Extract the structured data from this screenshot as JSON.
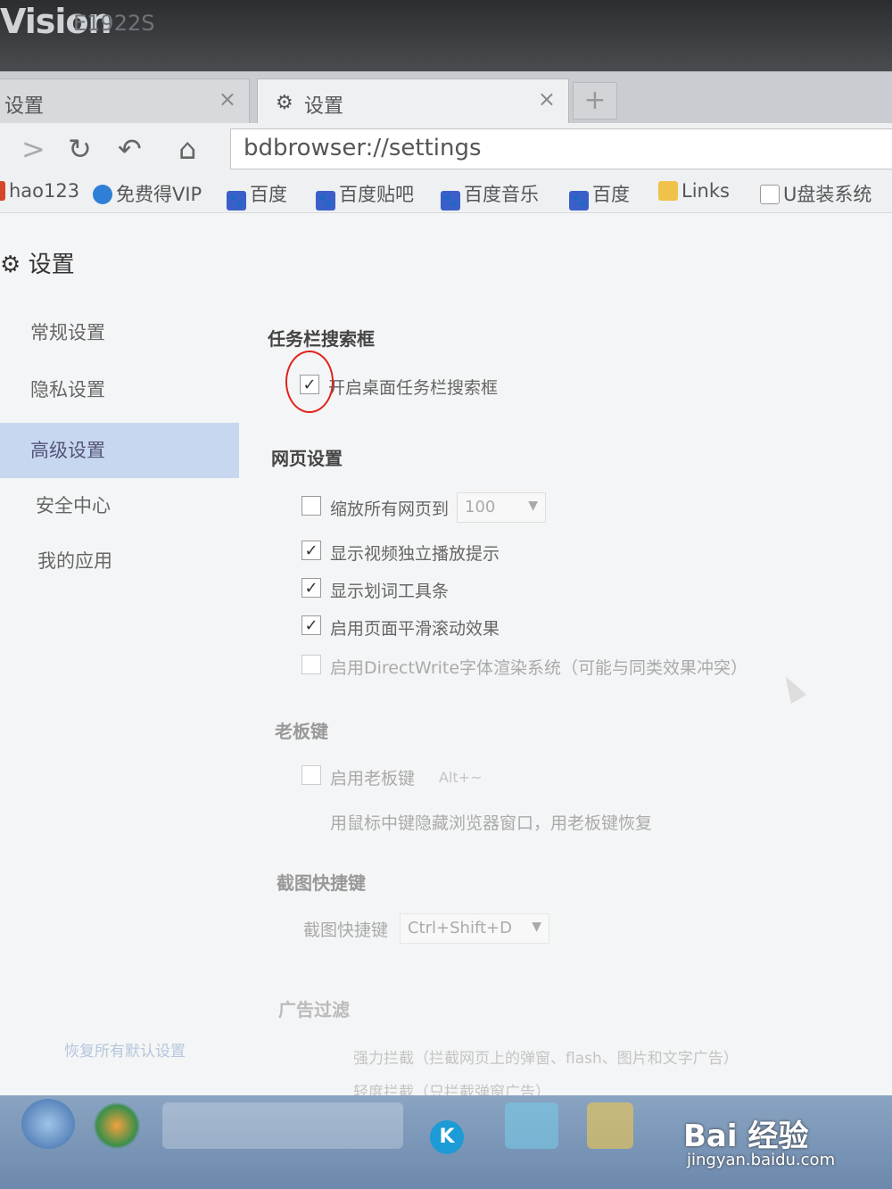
{
  "monitor": {
    "brand": "Vision",
    "model": "E1922S"
  },
  "tabs": [
    {
      "label": "设置",
      "close": "×"
    },
    {
      "label": "设置",
      "close": "×"
    }
  ],
  "new_tab": "+",
  "toolbar": {
    "forward_glyph": ">",
    "reload_glyph": "↻",
    "undo_glyph": "↶",
    "home_glyph": "⌂",
    "address": "bdbrowser://settings"
  },
  "bookmarks": [
    {
      "label": "hao123",
      "icon": "hao123-icon"
    },
    {
      "label": "免费得VIP",
      "icon": "vip-icon"
    },
    {
      "label": "百度",
      "icon": "baidu-paw-icon"
    },
    {
      "label": "百度贴吧",
      "icon": "baidu-paw-icon"
    },
    {
      "label": "百度音乐",
      "icon": "baidu-paw-icon"
    },
    {
      "label": "百度",
      "icon": "baidu-paw-icon"
    },
    {
      "label": "Links",
      "icon": "folder-icon"
    },
    {
      "label": "U盘装系统",
      "icon": "document-icon"
    }
  ],
  "settings": {
    "title": "设置",
    "sidebar": [
      {
        "label": "常规设置"
      },
      {
        "label": "隐私设置"
      },
      {
        "label": "高级设置",
        "active": true
      },
      {
        "label": "安全中心"
      },
      {
        "label": "我的应用"
      }
    ],
    "restore_link": "恢复所有默认设置",
    "sections": {
      "taskbar_search": {
        "title": "任务栏搜索框",
        "option": "开启桌面任务栏搜索框",
        "checked": true
      },
      "webpage": {
        "title": "网页设置",
        "zoom_label": "缩放所有网页到",
        "zoom_value": "100",
        "options": [
          {
            "label": "显示视频独立播放提示",
            "checked": true
          },
          {
            "label": "显示划词工具条",
            "checked": true
          },
          {
            "label": "启用页面平滑滚动效果",
            "checked": true
          },
          {
            "label": "启用DirectWrite字体渲染系统（可能与同类效果冲突）",
            "checked": false
          }
        ]
      },
      "boss_key": {
        "title": "老板键",
        "enable_label": "启用老板键",
        "key_value": "Alt+~",
        "hint": "用鼠标中键隐藏浏览器窗口，用老板键恢复"
      },
      "screenshot": {
        "title": "截图快捷键",
        "label": "截图快捷键",
        "value": "Ctrl+Shift+D"
      },
      "ad_filter": {
        "title": "广告过滤",
        "strong": "强力拦截（拦截网页上的弹窗、flash、图片和文字广告）",
        "light": "轻度拦截（只拦截弹窗广告）"
      }
    }
  },
  "taskbar": {
    "k_app": "K"
  },
  "watermark": {
    "main": "Bai 经验",
    "sub": "jingyan.baidu.com"
  },
  "colors": {
    "highlight": "#e0221c",
    "sidebar_active": "#c7d7f0"
  }
}
